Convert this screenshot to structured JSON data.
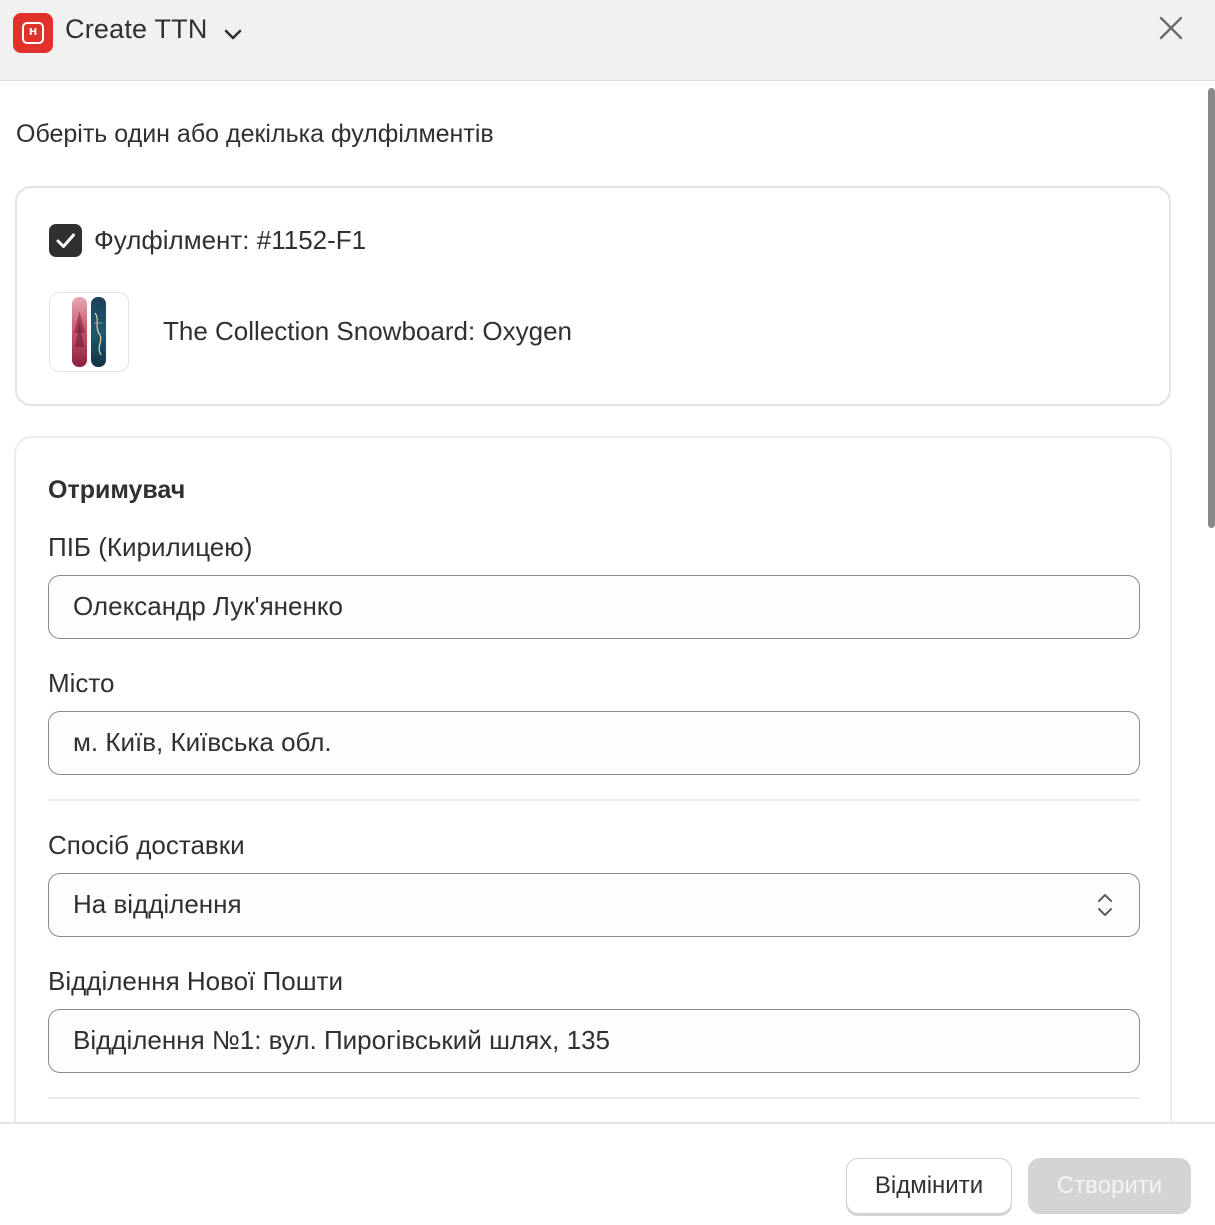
{
  "header": {
    "title": "Create TTN",
    "logo_letter": "Н",
    "brand_color": "#e0322a"
  },
  "main": {
    "section_title": "Оберіть один або декілька фулфілментів",
    "fulfillment": {
      "label": "Фулфілмент: #1152-F1",
      "checked": true,
      "product_name": "The Collection Snowboard: Oxygen"
    },
    "recipient": {
      "title": "Отримувач",
      "name_label": "ПІБ (Кирилицею)",
      "name_value": "Олександр Лук'яненко",
      "city_label": "Місто",
      "city_value": "м. Київ, Київська обл.",
      "delivery_label": "Спосіб доставки",
      "delivery_value": "На відділення",
      "branch_label": "Відділення Нової Пошти",
      "branch_value": "Відділення №1: вул. Пирогівський шлях, 135"
    }
  },
  "footer": {
    "cancel_label": "Відмінити",
    "create_label": "Створити"
  },
  "icons": {
    "close": "close-icon",
    "chevron": "chevron-down-icon",
    "check": "checkmark-icon",
    "select": "select-arrows-icon"
  }
}
